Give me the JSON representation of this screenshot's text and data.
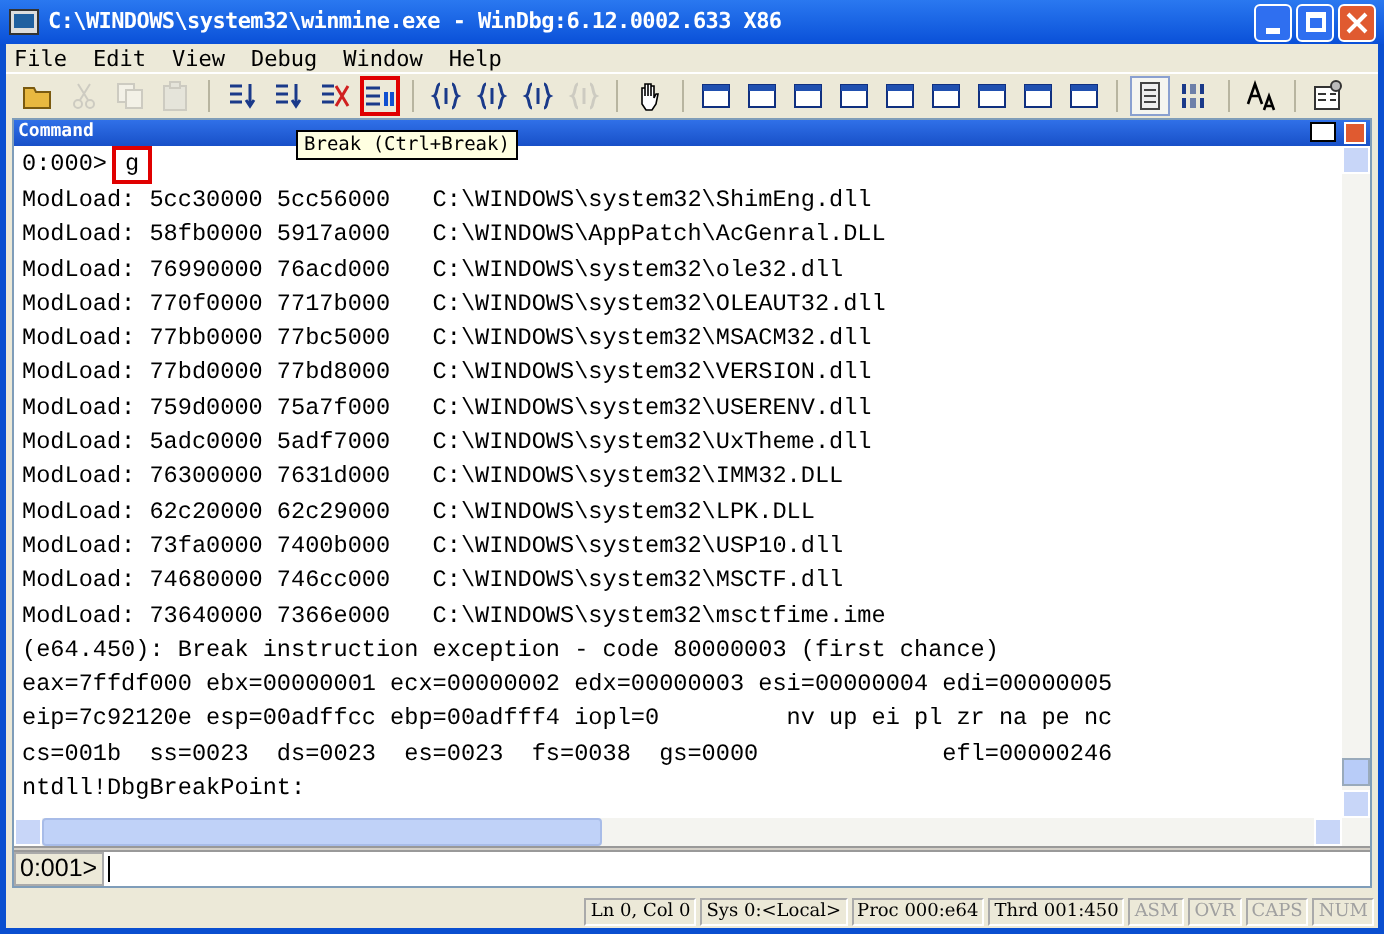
{
  "window": {
    "title": "C:\\WINDOWS\\system32\\winmine.exe - WinDbg:6.12.0002.633 X86"
  },
  "menu": [
    "File",
    "Edit",
    "View",
    "Debug",
    "Window",
    "Help"
  ],
  "toolbar": [
    {
      "buttons": [
        {
          "kind": "folder",
          "disabled": false,
          "highlighted": false,
          "pressed": false
        },
        {
          "kind": "cut",
          "disabled": true,
          "highlighted": false,
          "pressed": false
        },
        {
          "kind": "copy",
          "disabled": true,
          "highlighted": false,
          "pressed": false
        },
        {
          "kind": "paste",
          "disabled": true,
          "highlighted": false,
          "pressed": false
        }
      ]
    },
    {
      "buttons": [
        {
          "kind": "step",
          "disabled": false,
          "highlighted": false,
          "pressed": false
        },
        {
          "kind": "step",
          "disabled": false,
          "highlighted": false,
          "pressed": false
        },
        {
          "kind": "stop",
          "disabled": false,
          "highlighted": false,
          "pressed": false
        },
        {
          "kind": "break",
          "disabled": false,
          "highlighted": true,
          "pressed": false
        }
      ]
    },
    {
      "buttons": [
        {
          "kind": "brace",
          "disabled": false,
          "highlighted": false,
          "pressed": false
        },
        {
          "kind": "brace",
          "disabled": false,
          "highlighted": false,
          "pressed": false
        },
        {
          "kind": "brace",
          "disabled": false,
          "highlighted": false,
          "pressed": false
        },
        {
          "kind": "brace",
          "disabled": true,
          "highlighted": false,
          "pressed": false
        }
      ]
    },
    {
      "buttons": [
        {
          "kind": "hand",
          "disabled": false,
          "highlighted": false,
          "pressed": false
        }
      ]
    },
    {
      "buttons": [
        {
          "kind": "window",
          "disabled": false,
          "highlighted": false,
          "pressed": false
        },
        {
          "kind": "window",
          "disabled": false,
          "highlighted": false,
          "pressed": false
        },
        {
          "kind": "window",
          "disabled": false,
          "highlighted": false,
          "pressed": false
        },
        {
          "kind": "window",
          "disabled": false,
          "highlighted": false,
          "pressed": false
        },
        {
          "kind": "window",
          "disabled": false,
          "highlighted": false,
          "pressed": false
        },
        {
          "kind": "window",
          "disabled": false,
          "highlighted": false,
          "pressed": false
        },
        {
          "kind": "window",
          "disabled": false,
          "highlighted": false,
          "pressed": false
        },
        {
          "kind": "window",
          "disabled": false,
          "highlighted": false,
          "pressed": false
        },
        {
          "kind": "window",
          "disabled": false,
          "highlighted": false,
          "pressed": false
        }
      ]
    },
    {
      "buttons": [
        {
          "kind": "source",
          "disabled": false,
          "highlighted": false,
          "pressed": true
        },
        {
          "kind": "binary",
          "disabled": false,
          "highlighted": false,
          "pressed": false
        }
      ]
    },
    {
      "buttons": [
        {
          "kind": "font",
          "disabled": false,
          "highlighted": false,
          "pressed": false
        }
      ]
    },
    {
      "buttons": [
        {
          "kind": "options",
          "disabled": false,
          "highlighted": false,
          "pressed": false
        }
      ]
    }
  ],
  "tooltip": "Break (Ctrl+Break)",
  "command_window": {
    "title": "Command",
    "first_prompt": {
      "prompt": "0:000>",
      "command": "g",
      "highlighted": true
    },
    "output": [
      "ModLoad: 5cc30000 5cc56000   C:\\WINDOWS\\system32\\ShimEng.dll",
      "ModLoad: 58fb0000 5917a000   C:\\WINDOWS\\AppPatch\\AcGenral.DLL",
      "ModLoad: 76990000 76acd000   C:\\WINDOWS\\system32\\ole32.dll",
      "ModLoad: 770f0000 7717b000   C:\\WINDOWS\\system32\\OLEAUT32.dll",
      "ModLoad: 77bb0000 77bc5000   C:\\WINDOWS\\system32\\MSACM32.dll",
      "ModLoad: 77bd0000 77bd8000   C:\\WINDOWS\\system32\\VERSION.dll",
      "ModLoad: 759d0000 75a7f000   C:\\WINDOWS\\system32\\USERENV.dll",
      "ModLoad: 5adc0000 5adf7000   C:\\WINDOWS\\system32\\UxTheme.dll",
      "ModLoad: 76300000 7631d000   C:\\WINDOWS\\system32\\IMM32.DLL",
      "ModLoad: 62c20000 62c29000   C:\\WINDOWS\\system32\\LPK.DLL",
      "ModLoad: 73fa0000 7400b000   C:\\WINDOWS\\system32\\USP10.dll",
      "ModLoad: 74680000 746cc000   C:\\WINDOWS\\system32\\MSCTF.dll",
      "ModLoad: 73640000 7366e000   C:\\WINDOWS\\system32\\msctfime.ime",
      "(e64.450): Break instruction exception - code 80000003 (first chance)",
      "eax=7ffdf000 ebx=00000001 ecx=00000002 edx=00000003 esi=00000004 edi=00000005",
      "eip=7c92120e esp=00adffcc ebp=00adfff4 iopl=0         nv up ei pl zr na pe nc",
      "cs=001b  ss=0023  ds=0023  es=0023  fs=0038  gs=0000             efl=00000246",
      "ntdll!DbgBreakPoint:"
    ],
    "input_prompt": "0:001>"
  },
  "status_bar": [
    {
      "text": "Ln 0, Col 0",
      "disabled": false
    },
    {
      "text": "Sys 0:<Local>",
      "disabled": false
    },
    {
      "text": "Proc 000:e64",
      "disabled": false
    },
    {
      "text": "Thrd 001:450",
      "disabled": false
    },
    {
      "text": "ASM",
      "disabled": true
    },
    {
      "text": "OVR",
      "disabled": true
    },
    {
      "text": "CAPS",
      "disabled": true
    },
    {
      "text": "NUM",
      "disabled": true
    }
  ]
}
